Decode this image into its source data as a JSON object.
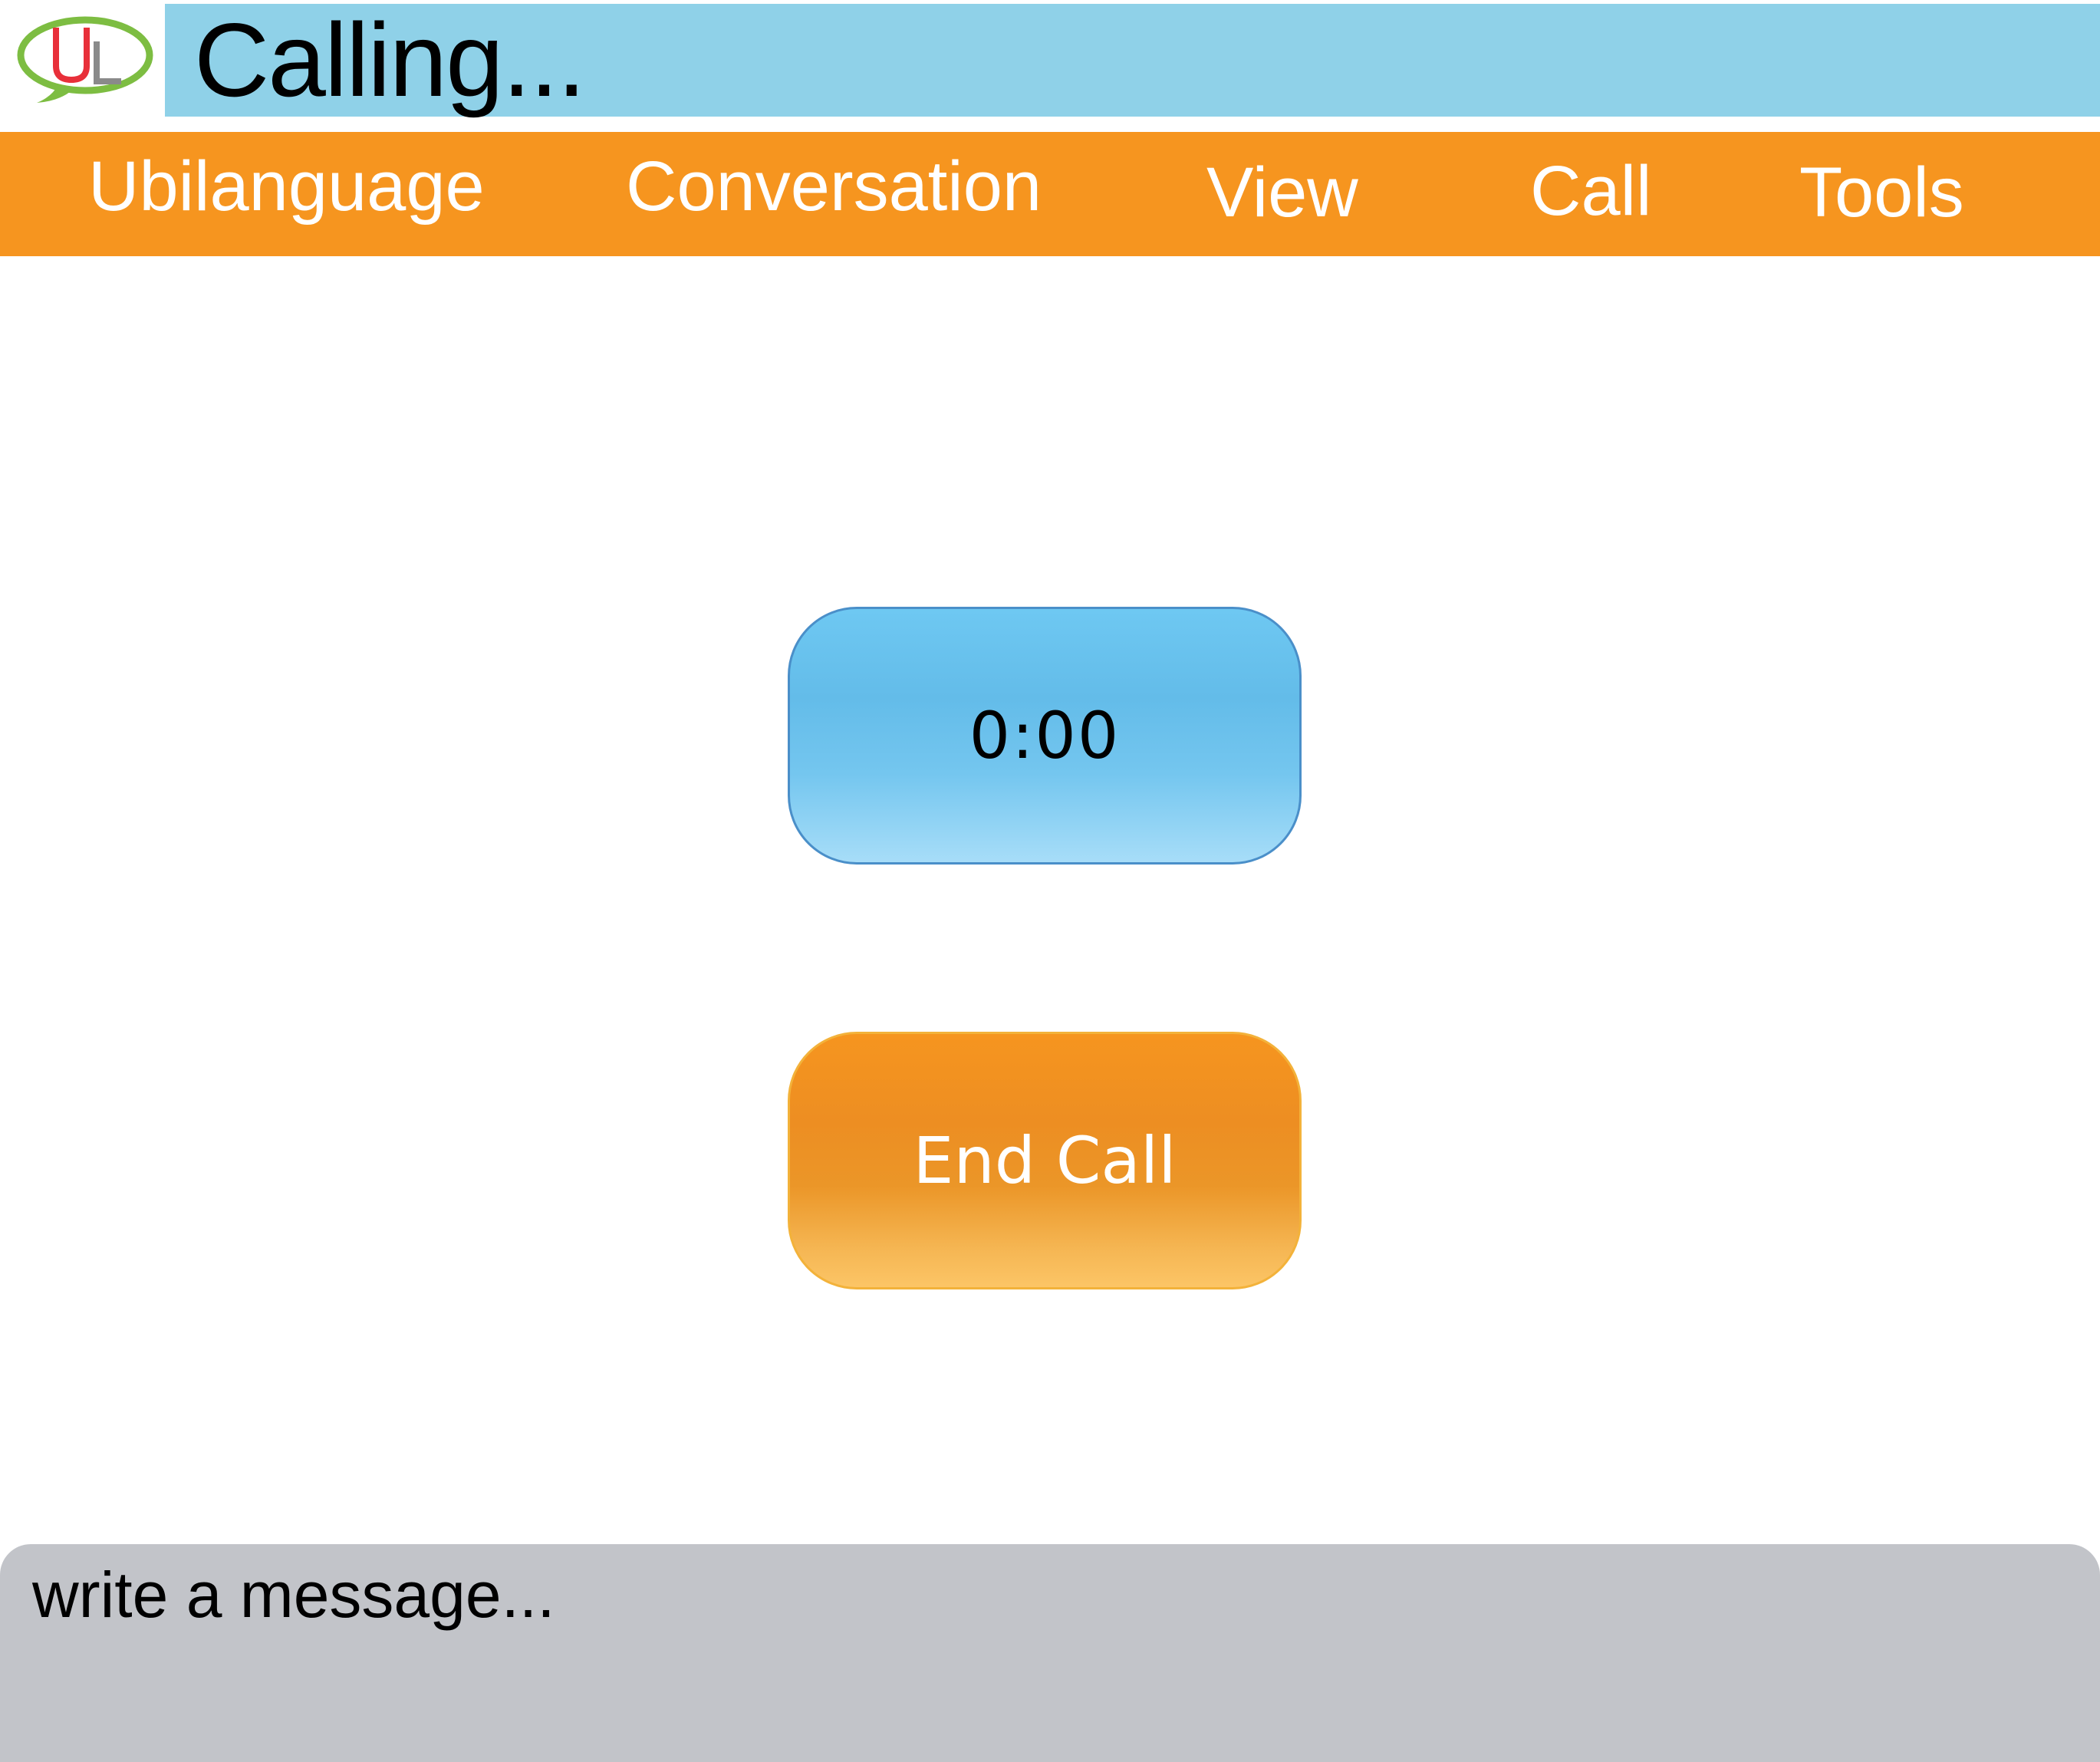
{
  "app": {
    "logo_text": "UL",
    "title": "Calling..."
  },
  "menu": {
    "items": [
      {
        "label": "Ubilanguage"
      },
      {
        "label": "Conversation"
      },
      {
        "label": "View"
      },
      {
        "label": "Call"
      },
      {
        "label": "Tools"
      }
    ]
  },
  "call": {
    "timer": "0:00",
    "end_label": "End Call"
  },
  "message": {
    "placeholder": "write a message..."
  },
  "colors": {
    "title_bar": "#8fd1e8",
    "menu_bar": "#f6951f",
    "timer_button": "#63bce9",
    "end_call_button": "#ed8e22",
    "message_box": "#c2c4c9",
    "logo_bubble": "#7dbd42",
    "logo_u": "#e8303a",
    "logo_l": "#8a8a8a"
  }
}
